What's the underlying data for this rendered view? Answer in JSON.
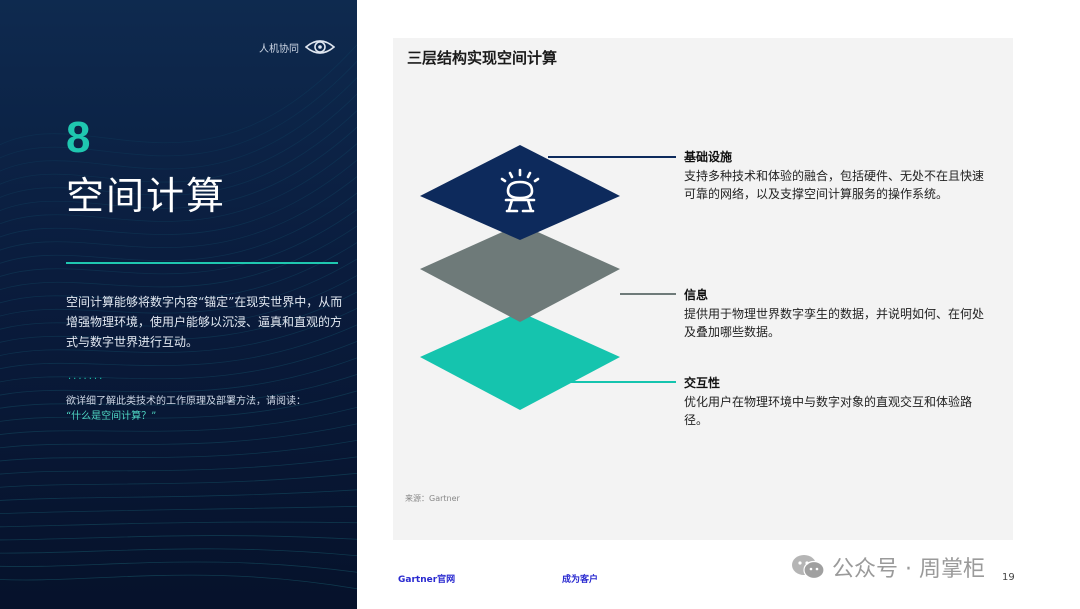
{
  "brand": {
    "name": "人机协同"
  },
  "section": {
    "number": "8",
    "title": "空间计算",
    "description": "空间计算能够将数字内容“锚定”在现实世界中，从而增强物理环境，使用户能够以沉浸、逼真和直观的方式与数字世界进行互动。",
    "dots": "·······",
    "read_more": "欲详细了解此类技术的工作原理及部署方法，请阅读：",
    "read_more_link": "“什么是空间计算？”"
  },
  "card": {
    "title": "三层结构实现空间计算",
    "layers": [
      {
        "name": "基础设施",
        "text": "支持多种技术和体验的融合，包括硬件、无处不在且快速可靠的网络，以及支撑空间计算服务的操作系统。",
        "color": "#0d2a5c"
      },
      {
        "name": "信息",
        "text": "提供用于物理世界数字孪生的数据，并说明如何、在何处及叠加哪些数据。",
        "color": "#6e7a79"
      },
      {
        "name": "交互性",
        "text": "优化用户在物理环境中与数字对象的直观交互和体验路径。",
        "color": "#15c4ae"
      }
    ],
    "source": "来源：Gartner"
  },
  "footer": {
    "link1": "Gartner官网",
    "link2": "成为客户",
    "page": "19",
    "watermark": "公众号 · 周掌柜"
  },
  "colors": {
    "teal": "#1fc7b0",
    "navy": "#0a1c3d",
    "link": "#2a2ad0"
  }
}
